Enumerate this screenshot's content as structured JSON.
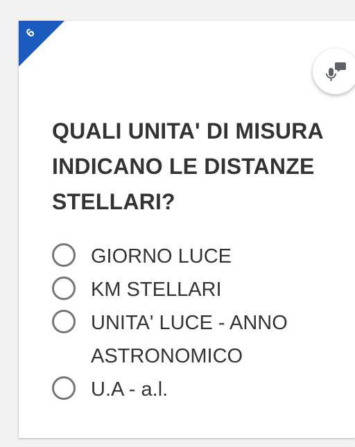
{
  "question_number": "6",
  "question_text": "QUALI UNITA' DI MISURA INDICANO LE DISTANZE STELLARI?",
  "audio_button_icon": "microphone-speech-icon",
  "options": [
    {
      "label": "GIORNO LUCE"
    },
    {
      "label": "KM STELLARI"
    },
    {
      "label": "UNITA' LUCE - ANNO ASTRONOMICO"
    },
    {
      "label": "U.A - a.l."
    }
  ],
  "colors": {
    "badge": "#1a5bbd",
    "text": "#333333",
    "radio_border": "#757575"
  }
}
